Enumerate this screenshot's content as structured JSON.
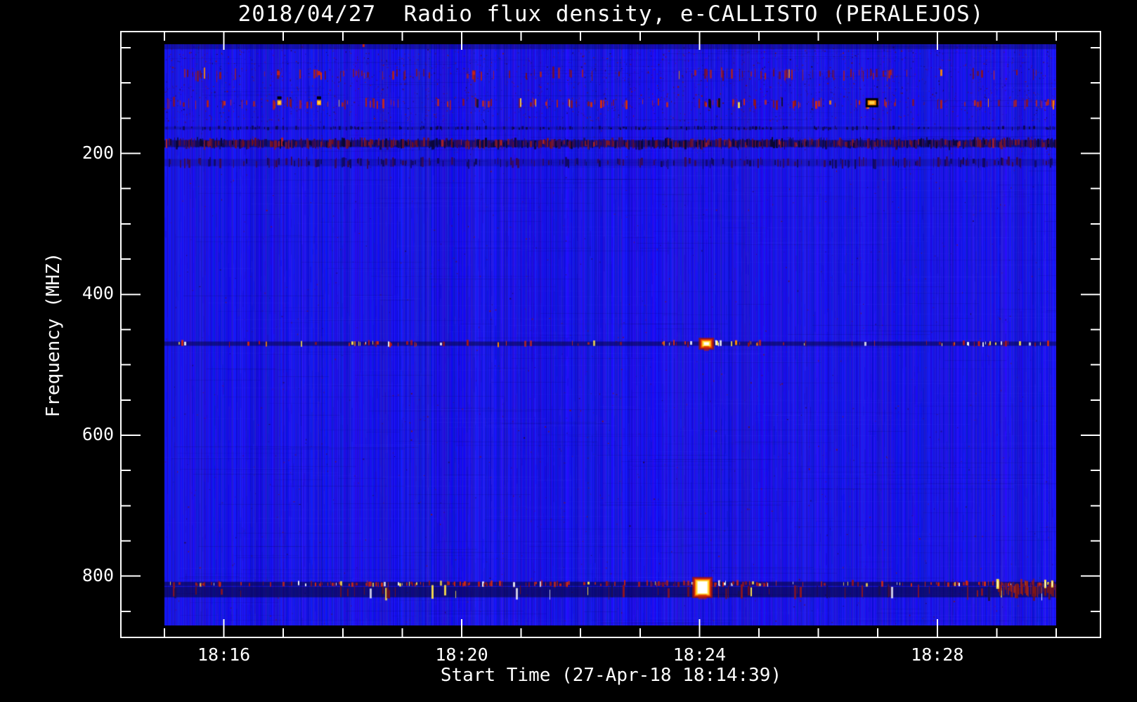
{
  "header": {
    "title": "2018/04/27  Radio flux density, e-CALLISTO (PERALEJOS)"
  },
  "chart_data": {
    "type": "heatmap",
    "subtype": "radio-spectrogram",
    "title": "2018/04/27  Radio flux density, e-CALLISTO (PERALEJOS)",
    "xlabel": "Start Time (27-Apr-18 18:14:39)",
    "ylabel": "Frequency (MHZ)",
    "instrument": "e-CALLISTO (PERALEJOS)",
    "date": "2018/04/27",
    "start_time_label": "27-Apr-18 18:14:39",
    "x_axis": {
      "start": "18:15:00",
      "end": "18:30:00",
      "minor_step_seconds": 60,
      "ticks_major": [
        {
          "label": "18:16",
          "time": "18:16:00"
        },
        {
          "label": "18:20",
          "time": "18:20:00"
        },
        {
          "label": "18:24",
          "time": "18:24:00"
        },
        {
          "label": "18:28",
          "time": "18:28:00"
        }
      ]
    },
    "y_axis": {
      "min_mhz": 45,
      "max_mhz": 870,
      "inverted": true,
      "minor_step_mhz": 50,
      "ticks_major": [
        {
          "label": "200",
          "mhz": 200
        },
        {
          "label": "400",
          "mhz": 400
        },
        {
          "label": "600",
          "mhz": 600
        },
        {
          "label": "800",
          "mhz": 800
        }
      ]
    },
    "colors": {
      "page_background": "#000000",
      "foreground": "#ffffff",
      "base_blue": "#1616d8",
      "hot_scale": [
        "#6e0f1e",
        "#c42318",
        "#ff8c00",
        "#ffe34a",
        "#ffffff"
      ]
    },
    "noise": {
      "count": 2800,
      "top_share": 0.62,
      "top_f0": 48,
      "top_f1": 155,
      "palette": [
        "#5a0d3a",
        "#7a1228",
        "#42105e",
        "#8c1414",
        "#220838"
      ]
    },
    "interference_bands": [
      {
        "name": "top-edge-rows",
        "f0": 45,
        "f1": 52,
        "density": 0,
        "palette": [],
        "bright": [],
        "bright_prob": 0,
        "base": "rgba(8,5,60,0.35)"
      },
      {
        "name": "fm-row-88",
        "f0": 82,
        "f1": 94,
        "density": 0.13,
        "palette": [
          "#8c1420",
          "#a82020",
          "#6e0f2e"
        ],
        "bright": [
          "#e03000",
          "#ff8c00"
        ],
        "bright_prob": 0.06,
        "windows": [
          [
            0,
            15,
            1
          ],
          [
            2.5,
            4.6,
            1.7
          ],
          [
            9.0,
            11.4,
            1.8
          ],
          [
            11.6,
            12.4,
            2.0
          ],
          [
            14.6,
            15,
            1.6
          ]
        ]
      },
      {
        "name": "fm-row-128",
        "f0": 124,
        "f1": 134,
        "density": 0.16,
        "palette": [
          "#8c1420",
          "#b42018",
          "#d02c10"
        ],
        "bright": [
          "#ff8c00",
          "#ffe34a",
          "#111111"
        ],
        "bright_prob": 0.08,
        "windows": [
          [
            0,
            15,
            1
          ],
          [
            1.8,
            2.9,
            1.6
          ],
          [
            9.0,
            11.4,
            1.9
          ],
          [
            11.6,
            12.3,
            2.2
          ],
          [
            14.6,
            15,
            1.7
          ]
        ]
      },
      {
        "name": "faint-row-164",
        "f0": 162,
        "f1": 166,
        "density": 0.25,
        "palette": [
          "#10095c",
          "#0c0748"
        ],
        "bright": [],
        "bright_prob": 0,
        "base": "rgba(10,6,60,0.22)"
      },
      {
        "name": "rfi-band-186",
        "f0": 181,
        "f1": 191,
        "density": 0.92,
        "palette": [
          "#6e0f1e",
          "#140a50",
          "#3a0a50",
          "#0a0630",
          "#801828"
        ],
        "bright": [
          "#b42424"
        ],
        "bright_prob": 0.03,
        "base": "rgba(8,4,40,0.5)"
      },
      {
        "name": "faint-row-213",
        "f0": 208,
        "f1": 218,
        "density": 0.3,
        "palette": [
          "#10095c",
          "#3a0a50"
        ],
        "bright": [],
        "bright_prob": 0,
        "base": "rgba(10,6,60,0.2)"
      },
      {
        "name": "sat-line-470",
        "f0": 467,
        "f1": 473,
        "density": 0.09,
        "palette": [
          "#b01818",
          "#d42a10",
          "#8c1420"
        ],
        "bright": [
          "#ffe34a",
          "#ffffff",
          "#ff8c00"
        ],
        "bright_prob": 0.3,
        "base": "rgba(6,4,48,0.5)",
        "windows": [
          [
            0,
            15,
            0.6
          ],
          [
            3.0,
            4.7,
            3.0
          ],
          [
            5.6,
            8.0,
            1.1
          ],
          [
            8.3,
            10.0,
            3.4
          ],
          [
            13.2,
            14.8,
            2.2
          ]
        ]
      },
      {
        "name": "rfi-row-809",
        "f0": 808,
        "f1": 814,
        "density": 0.26,
        "palette": [
          "#c41f10",
          "#d42a10",
          "#8c1420"
        ],
        "bright": [
          "#ffffff",
          "#ffe34a"
        ],
        "bright_prob": 0.17,
        "base": "rgba(6,4,44,0.55)",
        "windows": [
          [
            0,
            15,
            1
          ],
          [
            2.3,
            4.3,
            1.7
          ],
          [
            8.0,
            10.2,
            2.0
          ],
          [
            13.6,
            15,
            1.5
          ]
        ]
      },
      {
        "name": "rfi-band-818",
        "f0": 815,
        "f1": 830,
        "density": 0.09,
        "palette": [
          "#6e0f1e",
          "#8c1420",
          "#1a0f50"
        ],
        "bright": [
          "#ffe34a",
          "#ffffff"
        ],
        "bright_prob": 0.14,
        "base": "rgba(5,3,38,0.55)",
        "windows": [
          [
            0,
            15,
            1
          ],
          [
            2.4,
            4.2,
            1.6
          ],
          [
            8.2,
            10.0,
            2.2
          ]
        ]
      },
      {
        "name": "red-tail-815",
        "f0": 810,
        "f1": 826,
        "density": 0.85,
        "palette": [
          "#8c1a14",
          "#a02218",
          "#7a1515"
        ],
        "bright": [
          "#ffe34a"
        ],
        "bright_prob": 0.05,
        "windows": [
          [
            0,
            14.0,
            0
          ],
          [
            14.0,
            15,
            1
          ]
        ]
      }
    ],
    "events": [
      {
        "time": "18:24:03",
        "freq_mhz": 816,
        "style": "flare",
        "w": 17,
        "h": 20
      },
      {
        "time": "18:24:07",
        "freq_mhz": 470,
        "style": "flare",
        "w": 10,
        "h": 7
      },
      {
        "time": "18:26:54",
        "freq_mhz": 128,
        "style": "ember",
        "w": 12,
        "h": 7
      },
      {
        "time": "18:16:56",
        "freq_mhz": 128,
        "style": "ember-small",
        "w": 6,
        "h": 7
      },
      {
        "time": "18:17:36",
        "freq_mhz": 128,
        "style": "ember-small",
        "w": 6,
        "h": 7
      },
      {
        "time": "18:16:55",
        "freq_mhz": 86,
        "style": "dot-red",
        "w": 4,
        "h": 6
      },
      {
        "time": "18:17:36",
        "freq_mhz": 86,
        "style": "dot-red",
        "w": 4,
        "h": 6
      },
      {
        "time": "18:20:12",
        "freq_mhz": 86,
        "style": "dot-red",
        "w": 4,
        "h": 5
      },
      {
        "time": "18:18:21",
        "freq_mhz": 47,
        "style": "dot-red",
        "w": 3,
        "h": 4
      },
      {
        "time": "18:29:01",
        "freq_mhz": 811,
        "style": "dash-yellow",
        "w": 4,
        "h": 14
      },
      {
        "time": "18:29:49",
        "freq_mhz": 811,
        "style": "dash-yellow",
        "w": 3,
        "h": 12
      },
      {
        "time": "18:29:56",
        "freq_mhz": 811,
        "style": "dash-yellow",
        "w": 3,
        "h": 10
      },
      {
        "time": "18:28:42",
        "freq_mhz": 470,
        "style": "dot-red",
        "w": 3,
        "h": 7
      }
    ]
  }
}
